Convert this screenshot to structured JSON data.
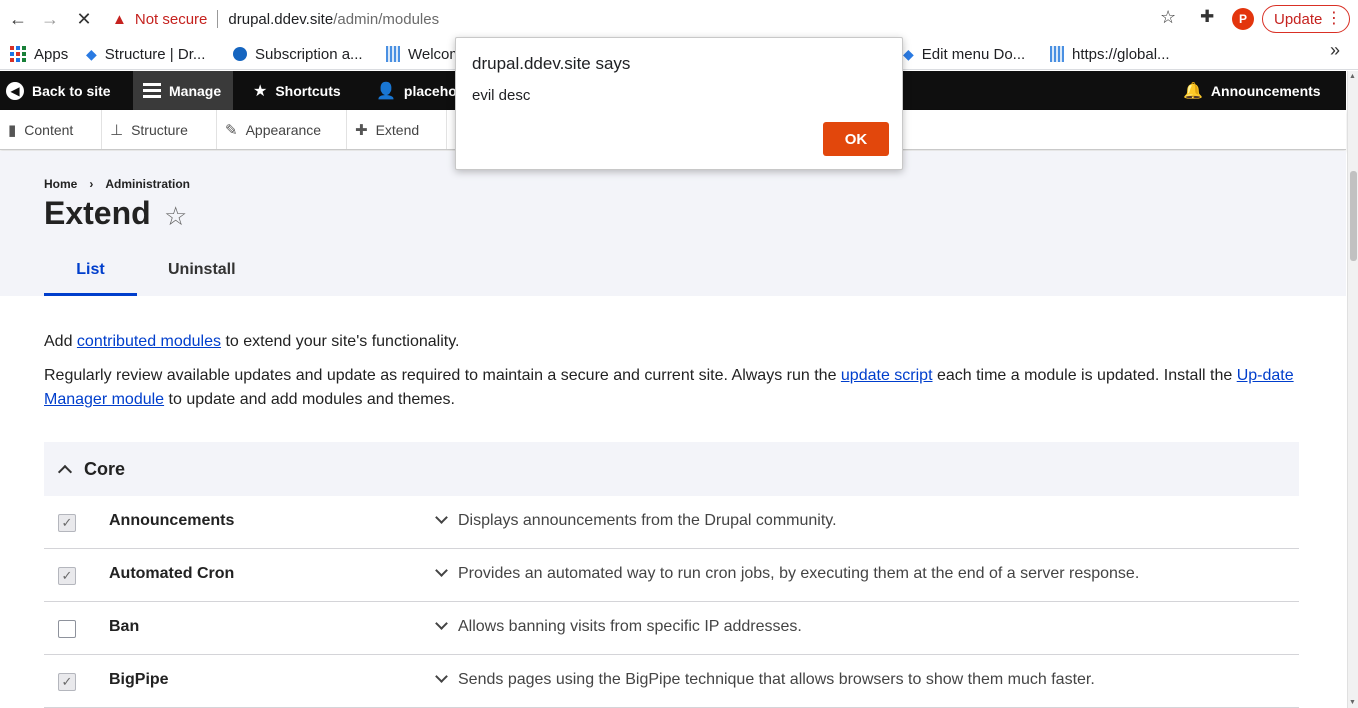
{
  "browser": {
    "url_warning": "Not secure",
    "url_host": "drupal.ddev.site",
    "url_path": "/admin/modules",
    "profile_initial": "P",
    "update_label": "Update",
    "bookmarks": [
      {
        "label": "Apps",
        "icon": "apps-grid-icon"
      },
      {
        "label": "Structure | Dr...",
        "icon": "drupal-drop-icon"
      },
      {
        "label": "Subscription a...",
        "icon": "blue-ball-icon"
      },
      {
        "label": "Welcom",
        "icon": "document-icon"
      },
      {
        "label": "Edit menu Do...",
        "icon": "drupal-drop-icon"
      },
      {
        "label": "https://global...",
        "icon": "document-icon"
      }
    ]
  },
  "toolbar": {
    "back_label": "Back to site",
    "manage_label": "Manage",
    "shortcuts_label": "Shortcuts",
    "user_label": "placeho",
    "announcements_label": "Announcements",
    "tray": [
      {
        "label": "Content",
        "icon": "file-icon"
      },
      {
        "label": "Structure",
        "icon": "sitemap-icon"
      },
      {
        "label": "Appearance",
        "icon": "brush-icon"
      },
      {
        "label": "Extend",
        "icon": "puzzle-icon"
      }
    ]
  },
  "breadcrumb": {
    "home": "Home",
    "separator": "›",
    "current": "Administration"
  },
  "page": {
    "title": "Extend",
    "tabs": [
      {
        "label": "List",
        "active": true
      },
      {
        "label": "Uninstall",
        "active": false
      }
    ],
    "intro_pre": "Add ",
    "intro_link": "contributed modules",
    "intro_post": " to extend your site's functionality.",
    "p2_pre": "Regularly review available updates and update as required to maintain a secure and current site. Always run the ",
    "p2_link1": "update script",
    "p2_mid": " each time a module is updated. Install the ",
    "p2_link2": "Up-date Manager module",
    "p2_post": " to update and add modules and themes."
  },
  "modules": {
    "group_label": "Core",
    "rows": [
      {
        "name": "Announcements",
        "description": "Displays announcements from the Drupal community.",
        "enabled": true
      },
      {
        "name": "Automated Cron",
        "description": "Provides an automated way to run cron jobs, by executing them at the end of a server response.",
        "enabled": true
      },
      {
        "name": "Ban",
        "description": "Allows banning visits from specific IP addresses.",
        "enabled": false
      },
      {
        "name": "BigPipe",
        "description": "Sends pages using the BigPipe technique that allows browsers to show them much faster.",
        "enabled": true
      }
    ]
  },
  "dialog": {
    "title": "drupal.ddev.site says",
    "message": "evil desc",
    "ok_label": "OK"
  },
  "colors": {
    "accent": "#003ecc",
    "toolbar": "#0f0f0f",
    "header_bg": "#f3f4f9",
    "dialog_button": "#e2470c",
    "warning": "#c5221f"
  }
}
